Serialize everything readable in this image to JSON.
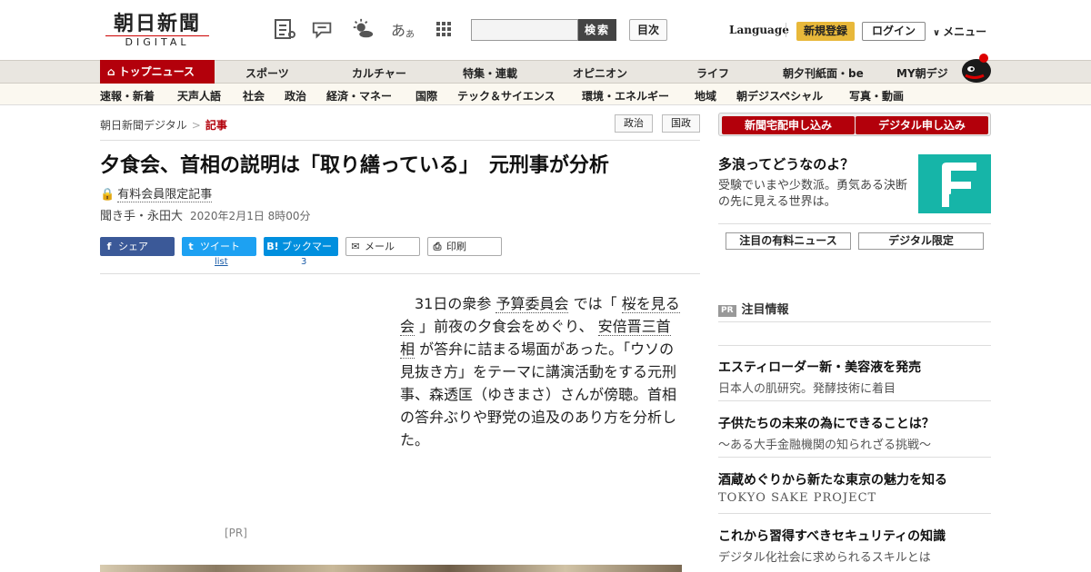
{
  "header": {
    "logo_main": "朝日新聞",
    "logo_sub": "DIGITAL",
    "font_toggle": "あ",
    "font_toggle_small": "あ",
    "search_placeholder": "",
    "search_button": "検索",
    "toc_button": "目次",
    "language": "Language",
    "register": "新規登録",
    "login": "ログイン",
    "menu": "メニュー",
    "icons": [
      "news-list-icon",
      "speech-bubble-icon",
      "weather-icon",
      "font-size-icon",
      "grid-icon"
    ]
  },
  "nav_primary": [
    {
      "label": "トップニュース",
      "active": true
    },
    {
      "label": "スポーツ"
    },
    {
      "label": "カルチャー"
    },
    {
      "label": "特集・連載"
    },
    {
      "label": "オピニオン"
    },
    {
      "label": "ライフ"
    },
    {
      "label": "朝夕刊紙面・be"
    },
    {
      "label": "MY朝デジ"
    }
  ],
  "nav_secondary": [
    "速報・新着",
    "天声人語",
    "社会",
    "政治",
    "経済・マネー",
    "国際",
    "テック＆サイエンス",
    "環境・エネルギー",
    "地域",
    "朝デジスペシャル",
    "写真・動画"
  ],
  "breadcrumb": {
    "home": "朝日新聞デジタル",
    "sep": ">",
    "current": "記事"
  },
  "tags": [
    "政治",
    "国政"
  ],
  "article": {
    "headline": "夕食会、首相の説明は「取り繕っている」　元刑事が分析",
    "paid_label": "有料会員限定記事",
    "byline": "聞き手・永田大",
    "date": "2020年2月1日 8時00分",
    "share": [
      {
        "label": "シェア",
        "icon": "f",
        "color": "#3b5998"
      },
      {
        "label": "ツイート",
        "icon": "t",
        "color": "#1da1f2",
        "sub": "list"
      },
      {
        "label": "ブックマーク",
        "icon": "B!",
        "color": "#008fde",
        "sub": "3"
      },
      {
        "label": "メール",
        "icon": "✉",
        "color": ""
      },
      {
        "label": "印刷",
        "icon": "⎙",
        "color": ""
      }
    ],
    "lede_parts": [
      {
        "t": "　31日の衆参"
      },
      {
        "t": "予算委員会",
        "link": true
      },
      {
        "t": "では「"
      },
      {
        "t": "桜を見る会",
        "link": true
      },
      {
        "t": "」前夜の夕食会をめぐり、"
      },
      {
        "t": "安倍晋三首相",
        "link": true
      },
      {
        "t": "が答弁に詰まる場面があった。「ウソの見抜き方」をテーマに講演活動をする元刑事、森透匡（ゆきまさ）さんが傍聴。首相の答弁ぶりや野党の追及のあり方を分析した。"
      }
    ],
    "pr_label": "[PR]"
  },
  "sidebar": {
    "promo_home": "新聞宅配申し込み",
    "promo_digital": "デジタル申し込み",
    "feature_title": "多浪ってどうなのよ？",
    "feature_desc": "受験でいまや少数派。勇気ある決断の先に見える世界は。",
    "btn_paid_news": "注目の有料ニュース",
    "btn_digital_only": "デジタル限定",
    "pr_badge": "PR",
    "pr_heading": "注目情報",
    "ads": [
      {
        "title": "エスティローダー新・美容液を発売",
        "sub": "日本人の肌研究。発酵技術に着目"
      },
      {
        "title": "子供たちの未来の為にできることは？",
        "sub": "～ある大手金融機関の知られざる挑戦～"
      },
      {
        "title": "酒蔵めぐりから新たな東京の魅力を知る",
        "sub": "TOKYO SAKE PROJECT"
      },
      {
        "title": "これから習得すべきセキュリティの知識",
        "sub": "デジタル化社会に求められるスキルとは"
      }
    ]
  },
  "colors": {
    "brand_red": "#b3000b",
    "register_yellow": "#e8b83a",
    "teal": "#16b5a8"
  }
}
